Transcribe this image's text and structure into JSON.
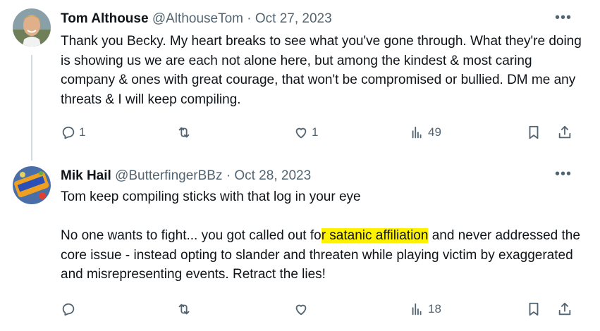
{
  "tweets": [
    {
      "name": "Tom Althouse",
      "handle": "@AlthouseTom",
      "separator": "·",
      "date": "Oct 27, 2023",
      "more": "•••",
      "paragraphs": [
        [
          "Thank you Becky. My heart breaks to see what you've gone through. What they're doing is showing us we are each not alone here, but among the kindest & most caring company & ones with great courage, that won't be compromised or bullied. DM me any threats & I will keep compiling."
        ]
      ],
      "replies": "1",
      "reposts": "",
      "likes": "1",
      "views": "49"
    },
    {
      "name": "Mik Hail",
      "handle": "@ButterfingerBBz",
      "separator": "·",
      "date": "Oct 28, 2023",
      "more": "•••",
      "body_p1": "Tom keep compiling sticks with that log in your eye",
      "body_p2_before": "No one wants to fight... you got called out fo",
      "body_p2_hl1": "r",
      "body_p2_hl2": " satanic affiliation",
      "body_p2_after": " and never addressed the core issue - instead opting to slander and threaten while playing victim by exaggerated and misrepresenting events. Retract the lies!",
      "replies": "",
      "reposts": "",
      "likes": "",
      "views": "18"
    }
  ],
  "colors": {
    "text": "#0f1419",
    "secondary": "#536471",
    "highlight": "#fff200",
    "thread_line": "#cfd9de"
  },
  "icons": [
    "reply-icon",
    "repost-icon",
    "like-icon",
    "views-icon",
    "bookmark-icon",
    "share-icon",
    "more-icon"
  ]
}
